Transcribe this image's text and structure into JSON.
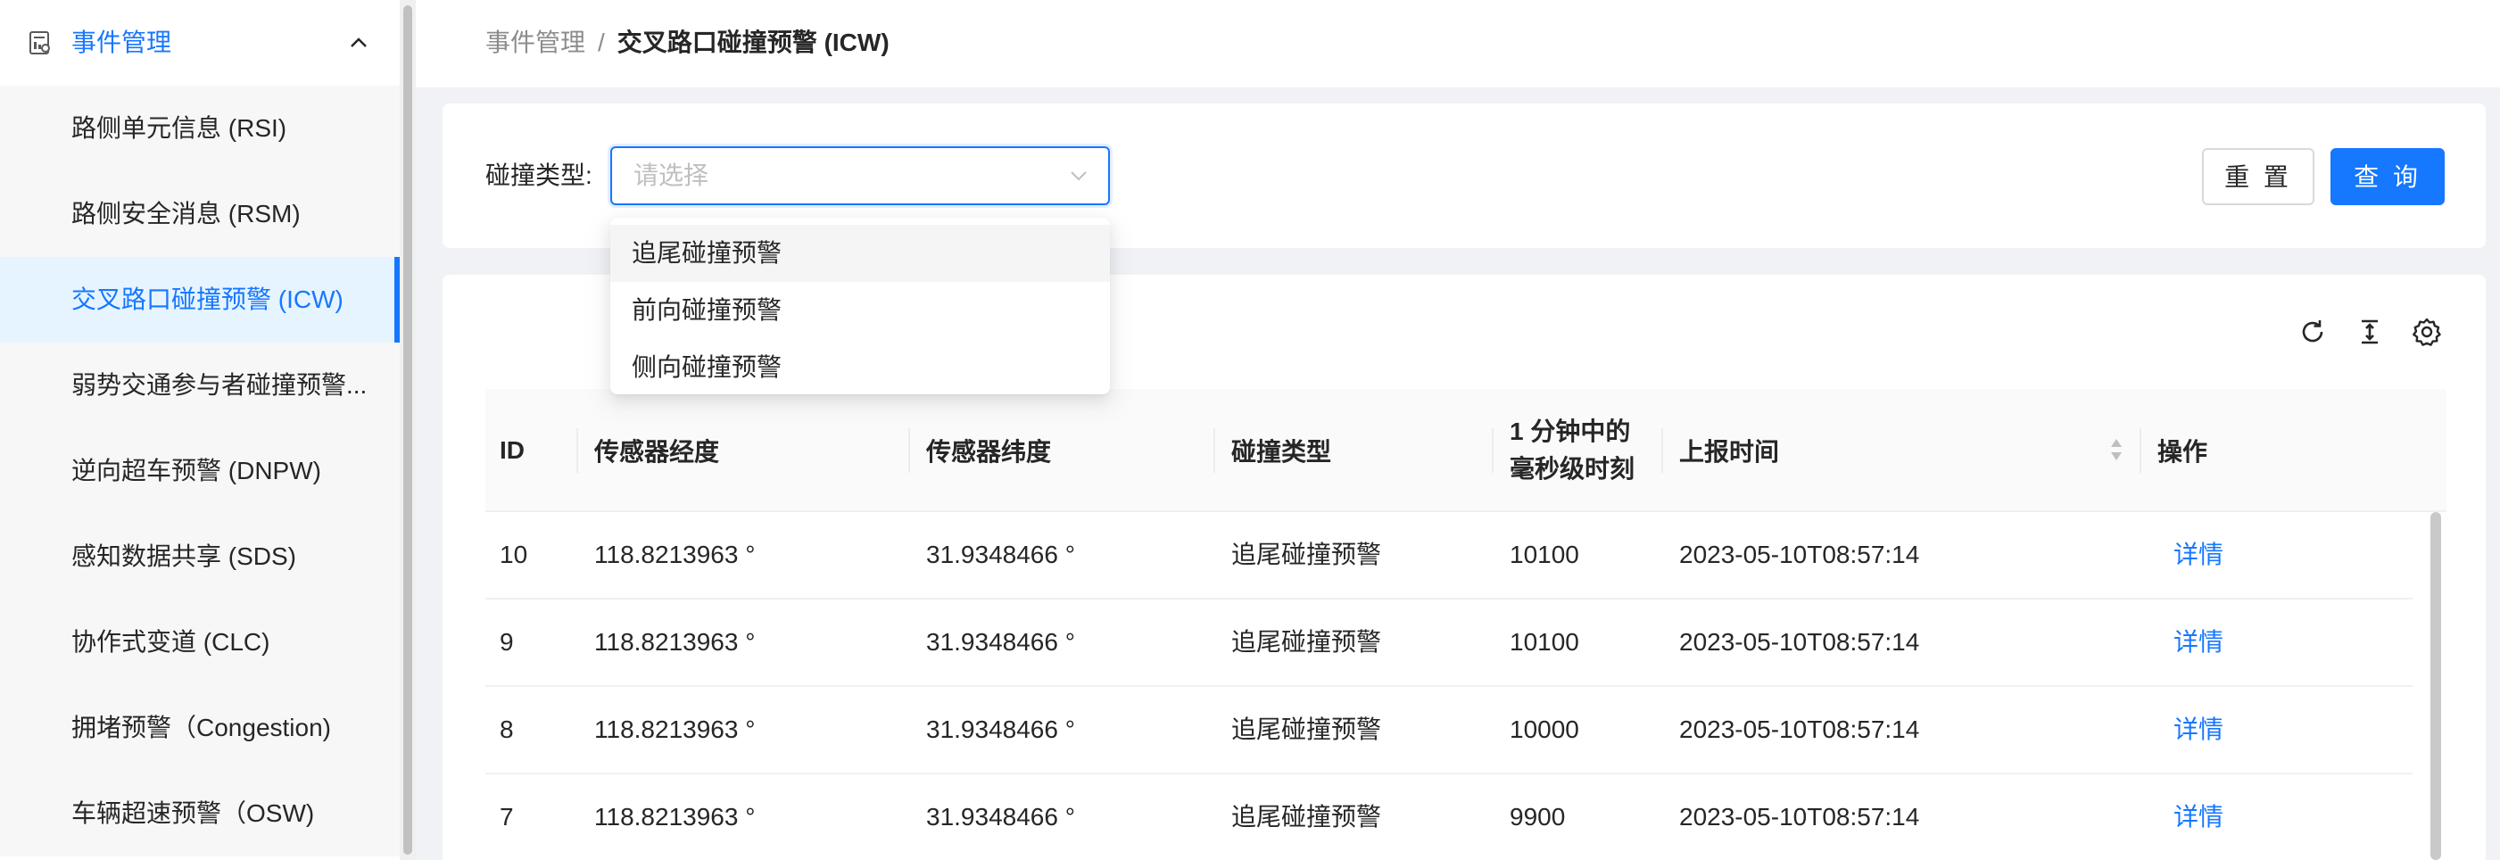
{
  "sidebar": {
    "group_label": "事件管理",
    "group_icon": "document-chart-icon",
    "collapse_icon": "chevron-up-icon",
    "items": [
      {
        "label": "路侧单元信息 (RSI)",
        "active": false
      },
      {
        "label": "路侧安全消息 (RSM)",
        "active": false
      },
      {
        "label": "交叉路口碰撞预警 (ICW)",
        "active": true
      },
      {
        "label": "弱势交通参与者碰撞预警...",
        "active": false
      },
      {
        "label": "逆向超车预警 (DNPW)",
        "active": false
      },
      {
        "label": "感知数据共享 (SDS)",
        "active": false
      },
      {
        "label": "协作式变道 (CLC)",
        "active": false
      },
      {
        "label": "拥堵预警（Congestion)",
        "active": false
      },
      {
        "label": "车辆超速预警（OSW)",
        "active": false
      }
    ]
  },
  "breadcrumb": {
    "parent": "事件管理",
    "separator": "/",
    "current": "交叉路口碰撞预警 (ICW)"
  },
  "filter": {
    "label": "碰撞类型:",
    "placeholder": "请选择",
    "reset_label": "重 置",
    "query_label": "查 询"
  },
  "dropdown": {
    "options": [
      "追尾碰撞预警",
      "前向碰撞预警",
      "侧向碰撞预警"
    ],
    "hovered_index": 0
  },
  "table": {
    "toolbar_icons": [
      "refresh-icon",
      "column-height-icon",
      "settings-icon"
    ],
    "columns": {
      "id": "ID",
      "lon": "传感器经度",
      "lat": "传感器纬度",
      "type": "碰撞类型",
      "ms_line1": "1 分钟中的",
      "ms_line2": "毫秒级时刻",
      "time": "上报时间",
      "action": "操作"
    },
    "rows": [
      {
        "id": "10",
        "lon": "118.8213963 °",
        "lat": "31.9348466 °",
        "type": "追尾碰撞预警",
        "ms": "10100",
        "time": "2023-05-10T08:57:14",
        "action": "详情"
      },
      {
        "id": "9",
        "lon": "118.8213963 °",
        "lat": "31.9348466 °",
        "type": "追尾碰撞预警",
        "ms": "10100",
        "time": "2023-05-10T08:57:14",
        "action": "详情"
      },
      {
        "id": "8",
        "lon": "118.8213963 °",
        "lat": "31.9348466 °",
        "type": "追尾碰撞预警",
        "ms": "10000",
        "time": "2023-05-10T08:57:14",
        "action": "详情"
      },
      {
        "id": "7",
        "lon": "118.8213963 °",
        "lat": "31.9348466 °",
        "type": "追尾碰撞预警",
        "ms": "9900",
        "time": "2023-05-10T08:57:14",
        "action": "详情"
      }
    ]
  },
  "colors": {
    "accent": "#1677ff",
    "active_bg": "#e6f4ff"
  }
}
